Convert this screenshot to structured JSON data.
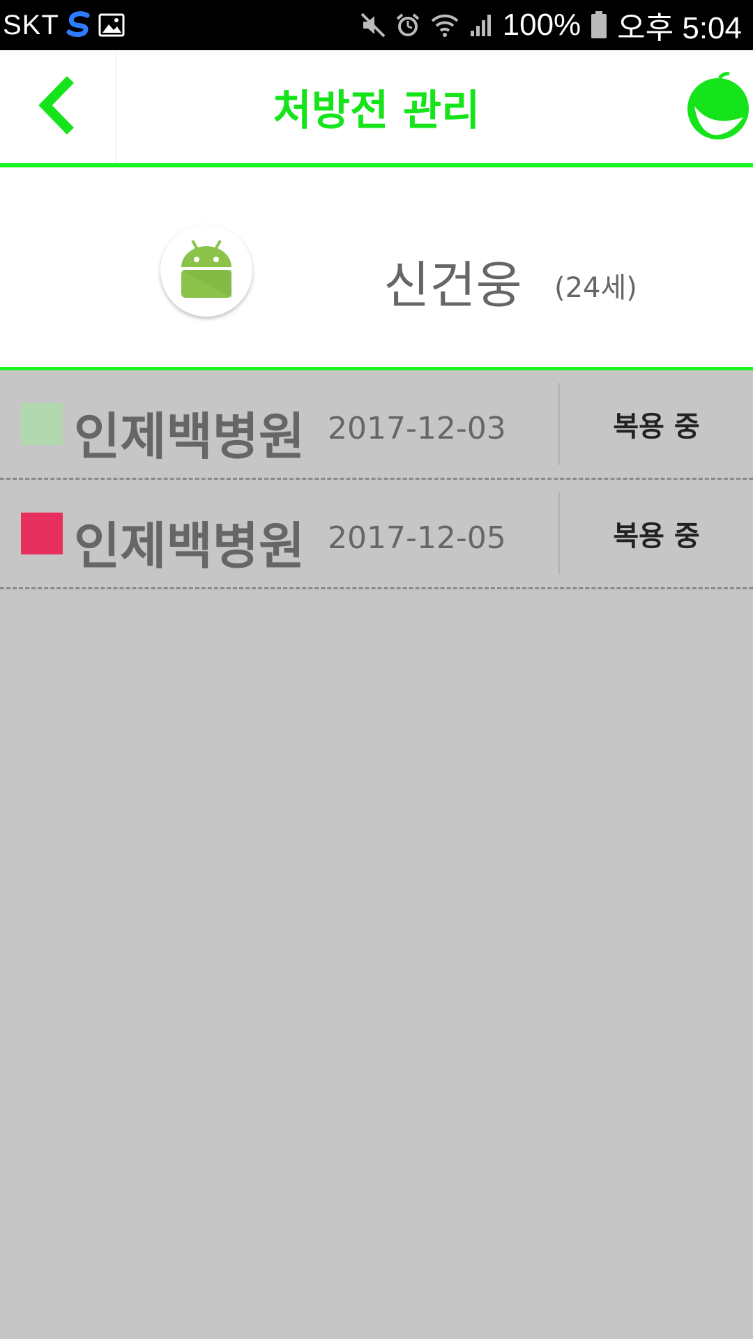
{
  "status_bar": {
    "carrier": "SKT",
    "battery": "100%",
    "time": "오후 5:04",
    "icons": [
      "samsung-s-icon",
      "gallery-icon",
      "mute-icon",
      "alarm-icon",
      "wifi-icon",
      "signal-icon",
      "battery-icon"
    ]
  },
  "app_bar": {
    "title": "처방전 관리",
    "accent_color": "#15f51f",
    "title_color": "#15e41a"
  },
  "patient": {
    "name": "신건웅",
    "age": "(24세)"
  },
  "prescriptions": [
    {
      "hospital": "인제백병원",
      "date": "2017-12-03",
      "status": "복용 중",
      "color": "#b2d8b0"
    },
    {
      "hospital": "인제백병원",
      "date": "2017-12-05",
      "status": "복용 중",
      "color": "#e8305e"
    }
  ]
}
